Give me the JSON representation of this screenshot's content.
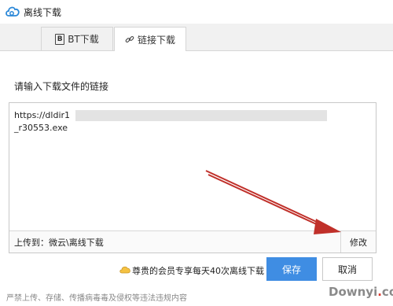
{
  "window": {
    "title": "离线下载"
  },
  "tabs": [
    {
      "label": "BT下载",
      "icon": "bt-icon",
      "active": false
    },
    {
      "label": "链接下载",
      "icon": "link-icon",
      "active": true
    }
  ],
  "prompt": "请输入下载文件的链接",
  "link_input": {
    "line1": "https://dldir1",
    "line2": "_r30553.exe"
  },
  "upload": {
    "label": "上传到：微云\\离线下载",
    "modify_label": "修改"
  },
  "vip": {
    "text": "尊贵的会员专享每天40次离线下载"
  },
  "buttons": {
    "save": "保存",
    "cancel": "取消"
  },
  "notice": "严禁上传、存储、传播病毒毒及侵权等违法违规内容",
  "watermark": {
    "prefix": "Downyi",
    "dot": ".",
    "suffix": "com"
  },
  "colors": {
    "accent": "#3f8de3",
    "arrow": "#c0302a"
  }
}
